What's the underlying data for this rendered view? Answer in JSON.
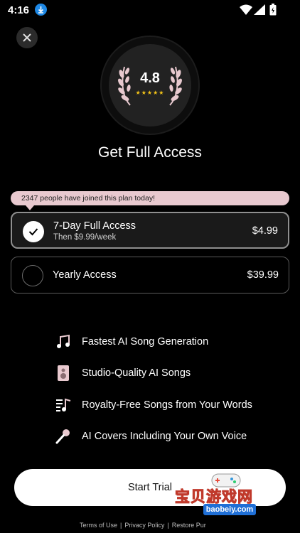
{
  "status_bar": {
    "time": "4:16"
  },
  "header": {
    "close_icon": "close-icon"
  },
  "rating": {
    "score": "4.8",
    "stars": "★★★★★"
  },
  "title": "Get Full Access",
  "banner": "2347 people have joined this plan today!",
  "plans": [
    {
      "name": "7-Day Full Access",
      "subtitle": "Then $9.99/week",
      "price": "$4.99",
      "selected": true
    },
    {
      "name": "Yearly Access",
      "price": "$39.99",
      "selected": false
    }
  ],
  "features": [
    {
      "icon": "music-note-icon",
      "label": "Fastest AI Song Generation"
    },
    {
      "icon": "speaker-icon",
      "label": "Studio-Quality AI Songs"
    },
    {
      "icon": "playlist-icon",
      "label": "Royalty-Free Songs from Your Words"
    },
    {
      "icon": "microphone-icon",
      "label": "AI Covers Including Your Own Voice"
    }
  ],
  "cta": {
    "label": "Start Trial"
  },
  "footer": {
    "terms": "Terms of Use",
    "privacy": "Privacy Policy",
    "restore": "Restore Pur"
  },
  "watermark": {
    "text": "宝贝游戏网",
    "url": "baobeiy.com"
  },
  "colors": {
    "accent_pink": "#e8c9cf",
    "star_gold": "#f5c518",
    "background": "#000000"
  }
}
